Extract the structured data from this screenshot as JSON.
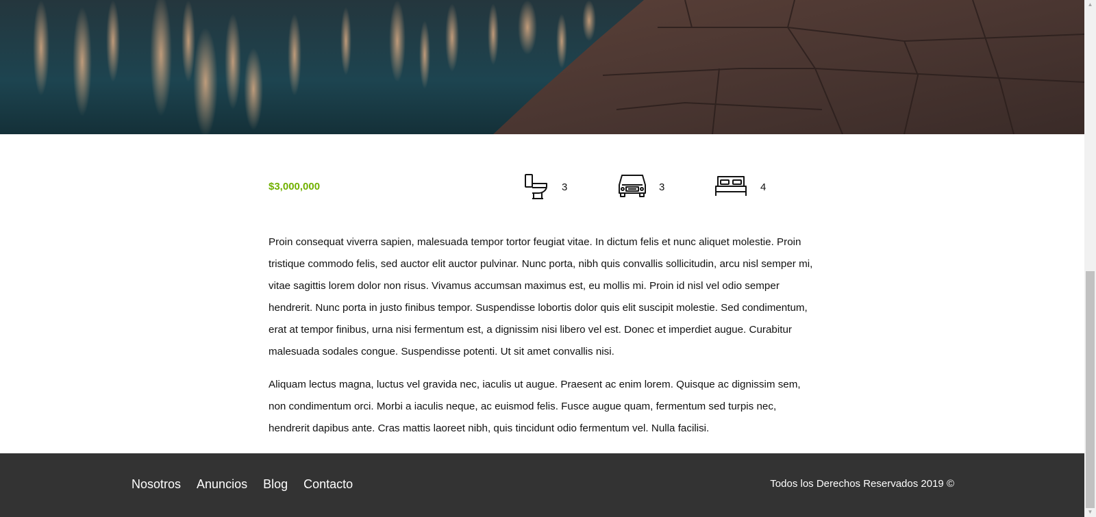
{
  "property": {
    "price": "$3,000,000",
    "features": [
      {
        "icon": "toilet-icon",
        "count": "3"
      },
      {
        "icon": "car-icon",
        "count": "3"
      },
      {
        "icon": "bed-icon",
        "count": "4"
      }
    ],
    "description": [
      "Proin consequat viverra sapien, malesuada tempor tortor feugiat vitae. In dictum felis et nunc aliquet molestie. Proin tristique commodo felis, sed auctor elit auctor pulvinar. Nunc porta, nibh quis convallis sollicitudin, arcu nisl semper mi, vitae sagittis lorem dolor non risus. Vivamus accumsan maximus est, eu mollis mi. Proin id nisl vel odio semper hendrerit. Nunc porta in justo finibus tempor. Suspendisse lobortis dolor quis elit suscipit molestie. Sed condimentum, erat at tempor finibus, urna nisi fermentum est, a dignissim nisi libero vel est. Donec et imperdiet augue. Curabitur malesuada sodales congue. Suspendisse potenti. Ut sit amet convallis nisi.",
      "Aliquam lectus magna, luctus vel gravida nec, iaculis ut augue. Praesent ac enim lorem. Quisque ac dignissim sem, non condimentum orci. Morbi a iaculis neque, ac euismod felis. Fusce augue quam, fermentum sed turpis nec, hendrerit dapibus ante. Cras mattis laoreet nibh, quis tincidunt odio fermentum vel. Nulla facilisi."
    ]
  },
  "footer": {
    "nav": [
      "Nosotros",
      "Anuncios",
      "Blog",
      "Contacto"
    ],
    "copyright": "Todos los Derechos Reservados 2019 ©"
  },
  "colors": {
    "price": "#71b100",
    "footer_bg": "#333333"
  }
}
